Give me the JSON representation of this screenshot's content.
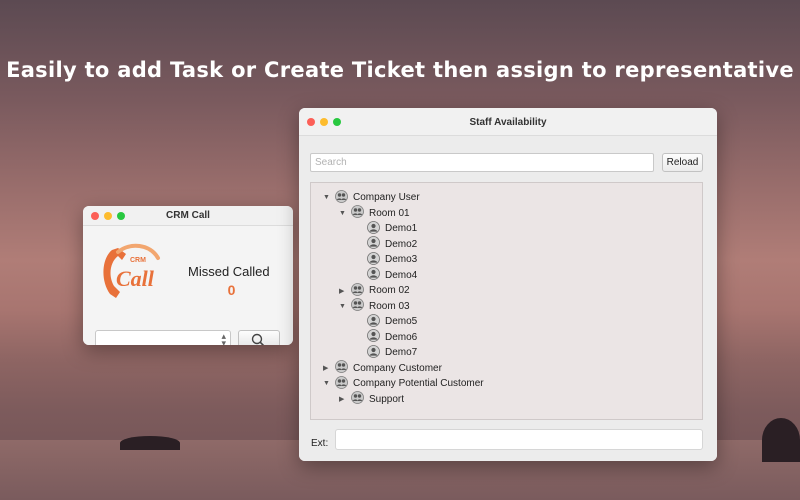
{
  "headline": "Easily to add Task or Create Ticket then assign to representative",
  "crm_window": {
    "title": "CRM Call",
    "logo_text": {
      "small": "CRM",
      "main": "Call"
    },
    "missed_label": "Missed Called",
    "missed_count": "0",
    "select_value": "",
    "search_icon": "magnifier-icon"
  },
  "staff_window": {
    "title": "Staff Availability",
    "search_placeholder": "Search",
    "reload_label": "Reload",
    "ext_label": "Ext:",
    "ext_value": "",
    "tree": [
      {
        "label": "Company User",
        "depth": 0,
        "expanded": true,
        "kind": "group"
      },
      {
        "label": "Room 01",
        "depth": 1,
        "expanded": true,
        "kind": "group"
      },
      {
        "label": "Demo1",
        "depth": 2,
        "kind": "user"
      },
      {
        "label": "Demo2",
        "depth": 2,
        "kind": "user"
      },
      {
        "label": "Demo3",
        "depth": 2,
        "kind": "user"
      },
      {
        "label": "Demo4",
        "depth": 2,
        "kind": "user"
      },
      {
        "label": "Room 02",
        "depth": 1,
        "expanded": false,
        "kind": "group"
      },
      {
        "label": "Room 03",
        "depth": 1,
        "expanded": true,
        "kind": "group"
      },
      {
        "label": "Demo5",
        "depth": 2,
        "kind": "user"
      },
      {
        "label": "Demo6",
        "depth": 2,
        "kind": "user"
      },
      {
        "label": "Demo7",
        "depth": 2,
        "kind": "user"
      },
      {
        "label": "Company Customer",
        "depth": 0,
        "expanded": false,
        "kind": "group"
      },
      {
        "label": "Company Potential Customer",
        "depth": 0,
        "expanded": true,
        "kind": "group"
      },
      {
        "label": "Support",
        "depth": 1,
        "expanded": false,
        "kind": "group"
      }
    ]
  },
  "colors": {
    "accent_orange": "#e8713a",
    "close": "#fc5f57",
    "minimize": "#fdbc2e",
    "zoom": "#28c840"
  }
}
